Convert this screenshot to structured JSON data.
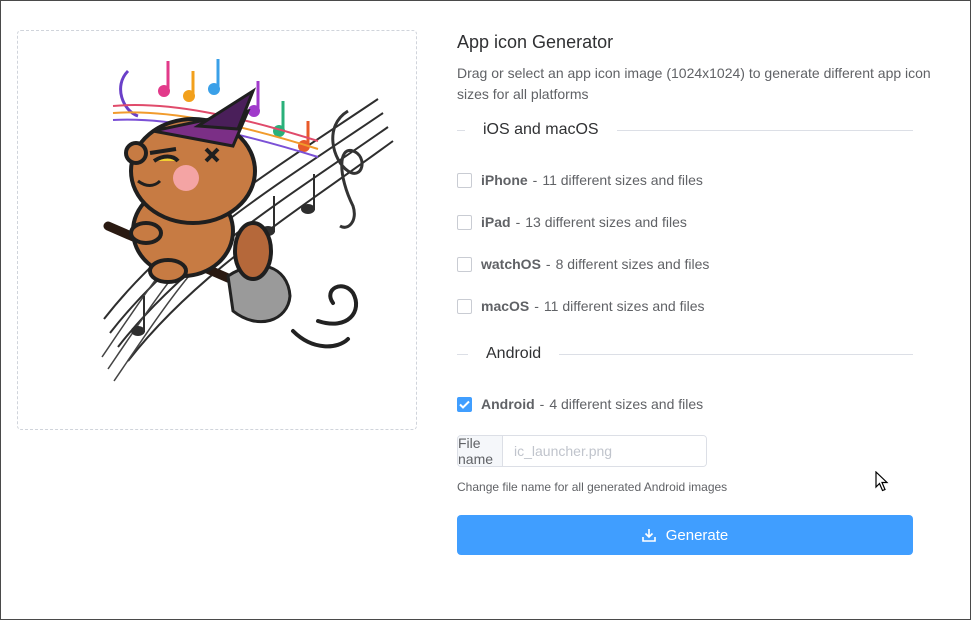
{
  "app": {
    "title": "App icon Generator",
    "description": "Drag or select an app icon image (1024x1024) to generate different app icon sizes for all platforms"
  },
  "sections": {
    "ios": {
      "label": "iOS and macOS"
    },
    "android": {
      "label": "Android"
    }
  },
  "options": [
    {
      "name": "iPhone",
      "sep": "-",
      "detail": "11 different sizes and files",
      "checked": false
    },
    {
      "name": "iPad",
      "sep": "-",
      "detail": "13 different sizes and files",
      "checked": false
    },
    {
      "name": "watchOS",
      "sep": "-",
      "detail": "8 different sizes and files",
      "checked": false
    },
    {
      "name": "macOS",
      "sep": "-",
      "detail": "11 different sizes and files",
      "checked": false
    },
    {
      "name": "Android",
      "sep": "-",
      "detail": "4 different sizes and files",
      "checked": true
    }
  ],
  "filename": {
    "prefix": "File name",
    "placeholder": "ic_launcher.png",
    "value": "",
    "hint": "Change file name for all generated Android images"
  },
  "generate": {
    "label": "Generate",
    "icon": "download-icon"
  },
  "preview": {
    "icon": "beaver-witch-music-image"
  },
  "colors": {
    "accent": "#409eff",
    "border": "#dcdfe6",
    "text": "#303133"
  }
}
